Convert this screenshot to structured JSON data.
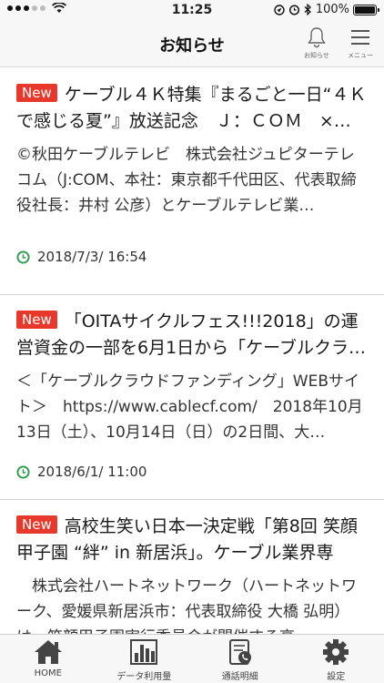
{
  "status": {
    "time": "11:25",
    "battery": "100%"
  },
  "header": {
    "title": "お知らせ",
    "bell_caption": "お知らせ",
    "menu_caption": "メニュー"
  },
  "badge_label": "New",
  "items": [
    {
      "title": "ケーブル４Ｋ特集『まるごと一日“４Ｋで感じる夏”』放送記念　Ｊ：ＣＯＭ　×…",
      "body": "©秋田ケーブルテレビ　株式会社ジュピターテレコム（J:COM、本社：東京都千代田区、代表取締役社長：井村 公彦）とケーブルテレビ業…",
      "date": "2018/7/3/ 16:54"
    },
    {
      "title": "「OITAサイクルフェス!!!2018」の運営資金の一部を6月1日から「ケーブルクラ…",
      "body": "＜「ケーブルクラウドファンディング」WEBサイト＞　https://www.cablecf.com/　2018年10月13日（土）、10月14日（日）の2日間、大…",
      "date": "2018/6/1/ 11:00"
    },
    {
      "title": "高校生笑い日本一決定戦「第8回 笑顔甲子園 “絆” in 新居浜」。ケーブル業界専用…",
      "body": "　株式会社ハートネットワーク（ハートネットワーク、愛媛県新居浜市：代表取締役 大橋 弘明）は、笑顔甲子園実行委員会が開催する高…",
      "date": ""
    }
  ],
  "tabs": [
    {
      "label": "HOME",
      "icon": "home-icon"
    },
    {
      "label": "データ利用量",
      "icon": "bar-chart-icon"
    },
    {
      "label": "通話明細",
      "icon": "call-detail-icon"
    },
    {
      "label": "設定",
      "icon": "gear-icon"
    }
  ],
  "colors": {
    "badge": "#e8382b",
    "clock": "#2e9c4c",
    "tab_icon": "#444444"
  }
}
